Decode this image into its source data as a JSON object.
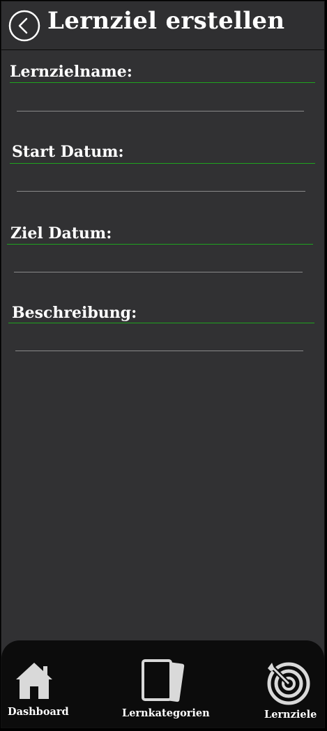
{
  "header": {
    "title": "Lernziel erstellen",
    "back_icon": "chevron-left-circle-icon"
  },
  "form": {
    "name_label": "Lernzielname:",
    "start_label": "Start Datum:",
    "end_label": "Ziel Datum:",
    "description_label": "Beschreibung:",
    "name_value": "",
    "start_value": "",
    "end_value": "",
    "description_value": ""
  },
  "nav": {
    "dashboard_label": "Dashboard",
    "categories_label": "Lernkategorien",
    "goals_label": "Lernziele"
  },
  "colors": {
    "background": "#313133",
    "accent_line": "#1fa31f",
    "nav_bg": "#0c0c0c",
    "icon": "#d9d9d9"
  }
}
